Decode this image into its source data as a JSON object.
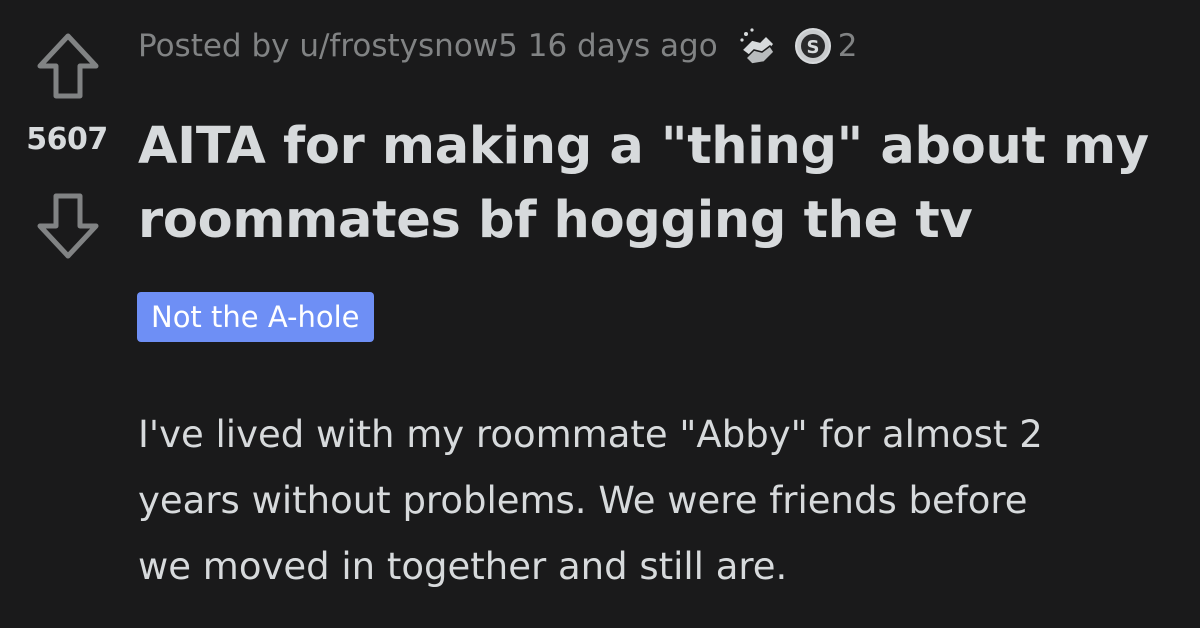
{
  "vote": {
    "score": "5607",
    "up_icon": "upvote-arrow-icon",
    "down_icon": "downvote-arrow-icon"
  },
  "meta": {
    "posted_by": "Posted by u/frostysnow5 16 days ago",
    "award_icons": [
      "handshake-award-icon",
      "silver-coin-award-icon"
    ],
    "award_count": "2"
  },
  "post": {
    "title": "AITA for making a \"thing\" about my roommates bf hogging the tv",
    "flair": "Not the A-hole",
    "flair_color": "#6e8ff5",
    "body_lines": [
      "I've lived with my roommate \"Abby\" for almost 2",
      "years without problems. We were friends before",
      "we moved in together and still are."
    ]
  },
  "theme": {
    "background": "#1a1a1b",
    "text": "#d7dadc",
    "muted": "#818384"
  }
}
